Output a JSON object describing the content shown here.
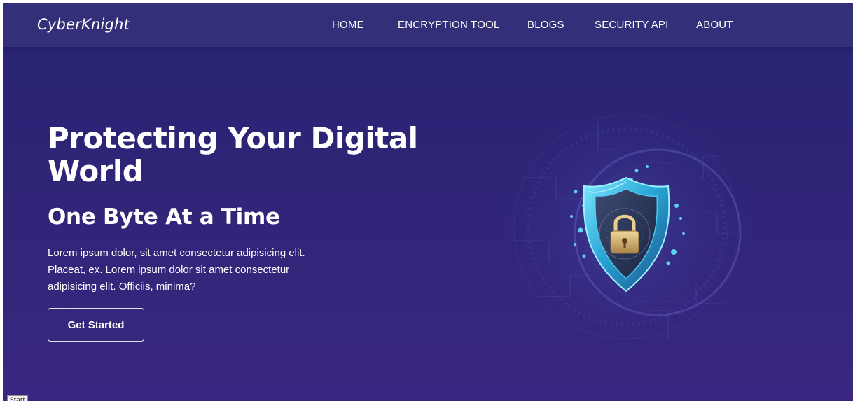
{
  "navbar": {
    "brand": "CyberKnight",
    "links": [
      {
        "label": "HOME"
      },
      {
        "label": "ENCRYPTION TOOL"
      },
      {
        "label": "BLOGS"
      },
      {
        "label": "SECURITY API"
      },
      {
        "label": "ABOUT"
      }
    ]
  },
  "hero": {
    "title": "Protecting Your Digital World",
    "subtitle": "One Byte At a Time",
    "description": "Lorem ipsum dolor, sit amet consectetur adipisicing elit. Placeat, ex. Lorem ipsum dolor sit amet consectetur adipisicing elit. Officiis, minima?",
    "cta_label": "Get Started",
    "illustration_icon": "shield-padlock-icon"
  },
  "tooltip": {
    "label": "Start"
  },
  "colors": {
    "navbar_bg": "#332f78",
    "hero_bg_top": "#272372",
    "hero_bg_bottom": "#3a2680",
    "text": "#ffffff",
    "shield_accent": "#3ec9f0"
  }
}
